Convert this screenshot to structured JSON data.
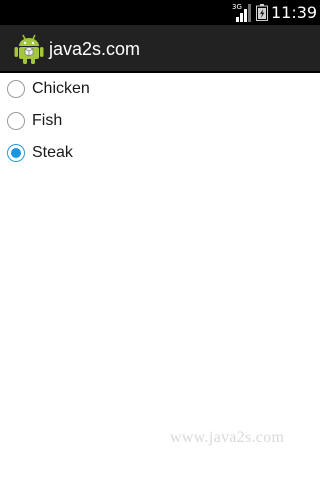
{
  "status_bar": {
    "network_label": "3G",
    "time": "11:39",
    "icons": [
      "signal-3g-icon",
      "battery-icon"
    ]
  },
  "action_bar": {
    "title": "java2s.com",
    "icon": "android-robot-icon"
  },
  "radio_group": {
    "options": [
      {
        "label": "Chicken",
        "checked": false
      },
      {
        "label": "Fish",
        "checked": false
      },
      {
        "label": "Steak",
        "checked": true
      }
    ],
    "selected": "Steak"
  },
  "watermark": {
    "text": "www.java2s.com"
  },
  "colors": {
    "status_bar_bg": "#000000",
    "action_bar_bg": "#222222",
    "radio_checked": "#1a96e0",
    "radio_border": "#9a9a9a"
  }
}
